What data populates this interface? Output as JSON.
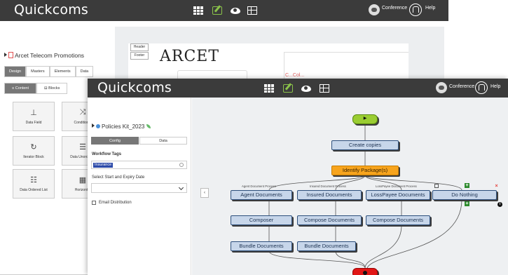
{
  "app_title": "Quickcoms",
  "topbar": {
    "conference_label": "Conference",
    "help_label": "Help"
  },
  "back_window": {
    "project_title": "Arcet Telecom Promotions",
    "tabs": [
      "Design",
      "Masters",
      "Elements",
      "Data"
    ],
    "subtabs": [
      "Content",
      "Blocks"
    ],
    "tiles": [
      {
        "label": "Data Field",
        "icon": "sitemap-icon"
      },
      {
        "label": "Conditional",
        "icon": "shuffle-icon"
      },
      {
        "label": "Iterator Block",
        "icon": "refresh-icon"
      },
      {
        "label": "Data Unordered",
        "icon": "list-icon"
      },
      {
        "label": "Data Ordered List",
        "icon": "ordered-list-icon"
      },
      {
        "label": "Horizontal",
        "icon": "table-icon"
      }
    ],
    "canvas": {
      "header_btn": "Header",
      "footer_btn": "Footer",
      "logo_text": "ARCET",
      "partial_text": "C...Col..."
    }
  },
  "front_window": {
    "project_title": "Policies Kit_2023",
    "tabs": [
      "Config",
      "Data"
    ],
    "workflow_tags_label": "Workflow Tags",
    "tag_chip": "Insurance",
    "date_label": "Select Start and Expiry Date",
    "date_value": "",
    "email_distribution_label": "Email Distribution",
    "collapse_glyph": "‹",
    "flow": {
      "start": "▶",
      "end": "●",
      "nodes": {
        "create_copies": "Create copies",
        "identify_package": "Identify Package(s)",
        "agent_documents": "Agent Documents",
        "insured_documents": "Insured Documents",
        "losspayee_documents": "LossPayee Documents",
        "do_nothing": "Do Nothing",
        "composer": "Composer",
        "compose_documents_1": "Compose Documents",
        "compose_documents_2": "Compose Documents",
        "bundle_documents_1": "Bundle Documents",
        "bundle_documents_2": "Bundle Documents"
      },
      "branch_labels": {
        "agent": "Agent Document Process",
        "insured": "Insured Document Process",
        "losspayee": "LossPayee Document Process"
      }
    }
  },
  "colors": {
    "topbar": "#3b3b3b",
    "node": "#c7d6ea",
    "accent_orange": "#f7a41d",
    "start_green": "#9acd32",
    "end_red": "#e01616"
  }
}
